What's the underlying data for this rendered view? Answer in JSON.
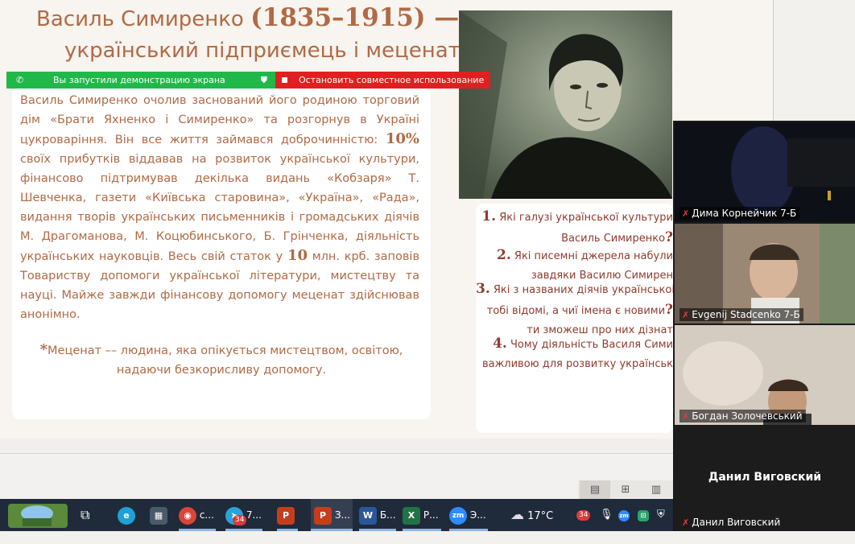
{
  "slide": {
    "title_part1": "Василь Симиренко",
    "title_years": "(1835–1915) —",
    "title_line2": "український підприємець і меценат",
    "para_1": "Василь Симиренко очолив заснований його родиною торговий дім «Брати Яхненко і Симиренко» та розгорнув в Україні цукроваріння. Він все життя займався доброчинністю:",
    "para_pct": "10%",
    "para_2": "своїх прибутків віддавав на розвиток української культури, фінансово підтримував декілька видань «Кобзаря» Т. Шевченка, газети «Київська старовина», «Україна», «Рада», видання творів українських письменників і громадських діячів М. Драгоманова, М. Коцюбинського, Б. Грінченка, діяльність українських науковців. Весь свій статок у",
    "para_amount": "10",
    "para_3": "млн. крб. заповів Товариству допомоги української літератури, мистецтву та науці. Майже завжди фінансову допомогу меценат здійснював анонімно.",
    "note_star": "*",
    "note_text": "Меценат –– людина, яка опікується мистецтвом, освітою, надаючи безкорисливу допомогу.",
    "questions": [
      {
        "num": "1.",
        "line1": "Які галузі української культури",
        "line2": "Василь Симиренко",
        "mark": "?"
      },
      {
        "num": "2.",
        "line1": "Які писемні джерела набули",
        "line2": "завдяки Василю Симирен"
      },
      {
        "num": "3.",
        "line1": "Які з названих діячів українськоі",
        "line2": "тобі відомі, а чиї імена є новими",
        "mark": "?",
        "line3": "ти зможеш про них дізнат"
      },
      {
        "num": "4.",
        "line1": "Чому діяльність Василя Сими",
        "line2": "важливою для розвитку українськ"
      }
    ]
  },
  "share_banner": {
    "sharing_label": "Вы запустили демонстрацию экрана",
    "stop_label": "Остановить совместное использование"
  },
  "participants": [
    {
      "name": "Дима Корнейчик 7-Б"
    },
    {
      "name": "Evgenij Stadcenko 7-Б"
    },
    {
      "name": "Богдан Золочевський"
    },
    {
      "name": "Данил Виговский",
      "center_name": "Данил Виговский"
    }
  ],
  "taskbar": {
    "items": [
      {
        "label": "с...",
        "icon": "chrome-icon"
      },
      {
        "label": "7...",
        "icon": "telegram-icon",
        "badge": "34"
      },
      {
        "label": "",
        "icon": "powerpoint-icon"
      },
      {
        "label": "З...",
        "icon": "powerpoint-icon"
      },
      {
        "label": "Б...",
        "icon": "word-icon"
      },
      {
        "label": "Р...",
        "icon": "excel-icon"
      },
      {
        "label": "Э...",
        "icon": "zoom-icon"
      }
    ],
    "weather": "17°C",
    "tray_badge": "34",
    "accent_colors": {
      "powerpoint": "#c43e1c",
      "word": "#2b579a",
      "excel": "#217346",
      "zoom": "#2d8cff",
      "telegram": "#2aa3d8"
    }
  }
}
